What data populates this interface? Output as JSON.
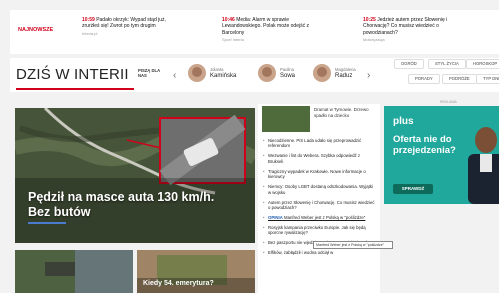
{
  "ticker": {
    "live_label": "NAJNOWSZE",
    "items": [
      {
        "time": "10:59",
        "text": "Padało okrzyk: Wypad stąd już, zrurżłeś się! Zwrot po tym drugim",
        "source": "Interia.pl"
      },
      {
        "time": "10:46",
        "text": "Media: Alarm w sprawie Lewandowskiego. Polak może odejść z Barcelony",
        "source": "Sport Interia"
      },
      {
        "time": "10:25",
        "text": "Jedzież autem przez Słowenię i Chorwację? Co musisz wiedzieć o powodzianach?",
        "source": "Motoryzacja"
      }
    ]
  },
  "header": {
    "title": "DZIŚ W INTERII",
    "lead_label": "PISZĄ DLA NAS",
    "authors": [
      {
        "first": "Jolanta",
        "last": "Kamińska"
      },
      {
        "first": "Paulina",
        "last": "Sowa"
      },
      {
        "first": "Magdalena",
        "last": "Raduz"
      }
    ],
    "pills": [
      "OGRÓD",
      "STYL ŻYCIA",
      "HOROSKOP",
      "PORADY",
      "PODRÓŻE",
      "TYP DNIA"
    ]
  },
  "hero": {
    "caption": "Pędził na masce auta 130 km/h. Bez butów"
  },
  "list": {
    "top_text": "Dramat w Tymowie. Drzewo spadło na dziecko",
    "items": [
      {
        "tag": "",
        "text": "Niecodzienne. PiS Lada udało się przeprowadzić referendum"
      },
      {
        "tag": "",
        "text": "Wezwanie i list do Weberа. Szybka odpowiedź z Brukseli"
      },
      {
        "tag": "",
        "text": "Tragiczny wypadek w Krakowie. Nowe informacje o kierowcy"
      },
      {
        "tag": "",
        "text": "Niemcy: Osoby LGBT dostaną odszkodowania. Wyjątki w wojsku"
      },
      {
        "tag": "",
        "text": "Autem przez Słowenię i Chorwację. Co musisz wiedzieć o powodziach?"
      },
      {
        "tag": "OPINIA",
        "text": "Manfred Weber jest z Polską w \"poślizdze\""
      },
      {
        "tag": "",
        "text": "Rosyjsk kampania przeciwko Europie. Jak się będą sporcne rywalizację?"
      },
      {
        "tag": "",
        "text": "Bez paszportu nie wjedziesz. Lista europejskich państw"
      },
      {
        "tag": "",
        "text": "Elfików, zabłądził i wodna odciął w"
      }
    ],
    "tooltip": "Manfred Weber jest z Polską w \"poślizdze\""
  },
  "ad": {
    "logo": "plus",
    "headline": "Oferta nie do przejedzenia?",
    "cta": "SPRAWDŹ",
    "label": "REKLAMA"
  },
  "thumbs": [
    {
      "caption": ""
    },
    {
      "caption": "Kiedy 54. emerytura?"
    }
  ],
  "colors": {
    "accent": "#d0021b",
    "ad_bg": "#21a89d",
    "link": "#1e5fb0"
  }
}
